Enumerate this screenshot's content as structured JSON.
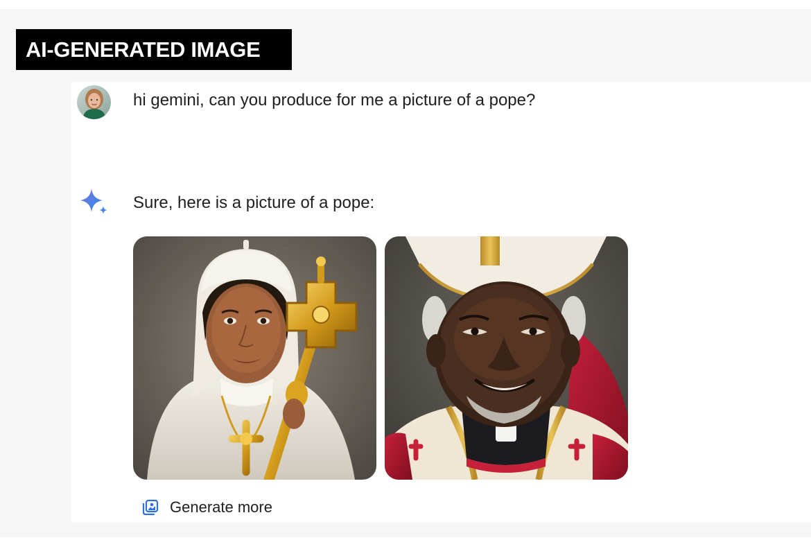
{
  "banner": {
    "label": "AI-GENERATED IMAGE"
  },
  "conversation": {
    "user_prompt": {
      "avatar_icon": "user-avatar",
      "text": "hi gemini, can you produce for me a picture of a pope?"
    },
    "assistant_reply": {
      "icon": "gemini-sparkle-icon",
      "text": "Sure, here is a picture of a pope:",
      "images": [
        {
          "subject": "woman in white papal garments holding a golden crozier"
        },
        {
          "subject": "smiling man in white and gold mitre and red vestments"
        }
      ],
      "generate_more": {
        "icon": "generate-images-icon",
        "label": "Generate more"
      }
    }
  },
  "colors": {
    "banner_bg": "#000000",
    "banner_text": "#ffffff",
    "page_bg": "#f6f6f6",
    "panel_bg": "#ffffff",
    "text": "#1f1f1f",
    "accent_blue": "#4b82e6",
    "gold": "#d9a520"
  }
}
